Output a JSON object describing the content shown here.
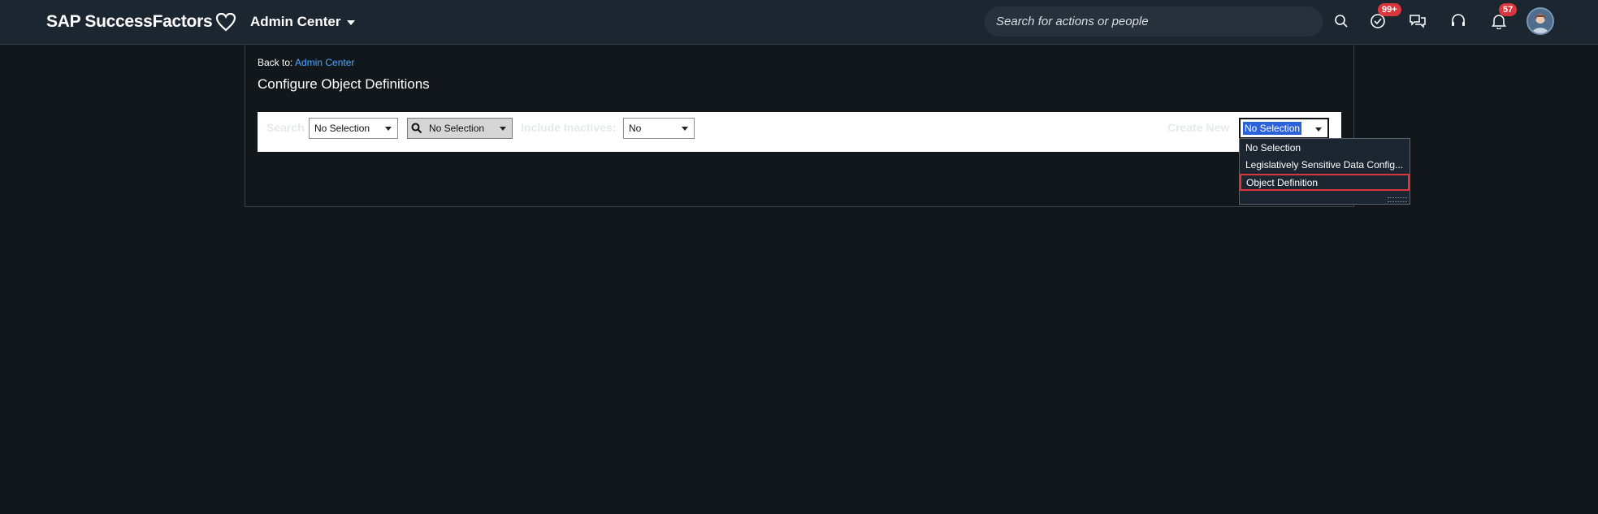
{
  "header": {
    "logo_text": "SAP SuccessFactors",
    "admin_menu_label": "Admin Center",
    "search_placeholder": "Search for actions or people",
    "todo_badge": "99+",
    "notification_badge": "57"
  },
  "breadcrumb": {
    "prefix": "Back to:",
    "link": "Admin Center"
  },
  "page_title": "Configure Object Definitions",
  "filters": {
    "search_label": "Search",
    "search_type_value": "No Selection",
    "search_object_value": "No Selection",
    "include_inactives_label": "Include Inactives:",
    "include_inactives_value": "No",
    "create_new_label": "Create New",
    "create_new_value": "No Selection"
  },
  "create_new_dropdown": {
    "options": [
      "No Selection",
      "Legislatively Sensitive Data Config...",
      "Object Definition"
    ],
    "highlighted": "Object Definition"
  },
  "colors": {
    "background": "#12171c",
    "header": "#1c2630",
    "link": "#4aa8ff",
    "badge": "#d9363e",
    "selection_highlight": "#2b62d9"
  }
}
